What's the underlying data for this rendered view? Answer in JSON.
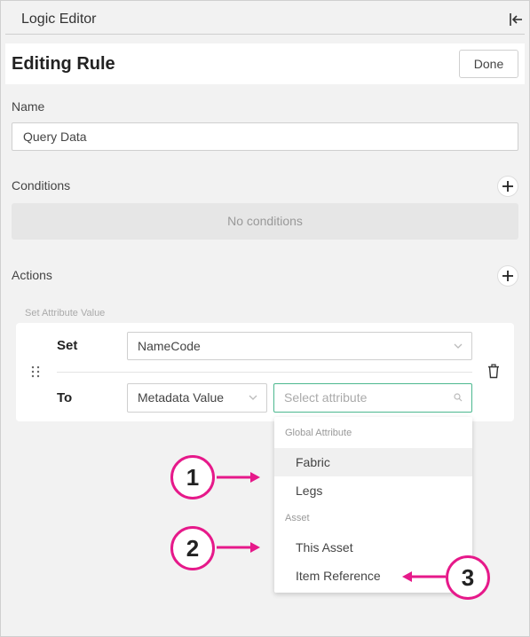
{
  "panel": {
    "title": "Logic Editor"
  },
  "rule": {
    "heading": "Editing Rule",
    "done_label": "Done"
  },
  "name_field": {
    "label": "Name",
    "value": "Query Data"
  },
  "conditions": {
    "label": "Conditions",
    "empty_text": "No conditions"
  },
  "actions": {
    "label": "Actions",
    "item": {
      "caption": "Set Attribute Value",
      "set_label": "Set",
      "set_value": "NameCode",
      "to_label": "To",
      "to_value": "Metadata Value",
      "attribute_placeholder": "Select attribute"
    }
  },
  "dropdown": {
    "groups": [
      {
        "header": "Global Attribute",
        "options": [
          "Fabric",
          "Legs"
        ]
      },
      {
        "header": "Asset",
        "options": [
          "This Asset",
          "Item Reference"
        ]
      }
    ]
  },
  "callouts": [
    "1",
    "2",
    "3"
  ],
  "colors": {
    "accent": "#e6198a",
    "focus": "#4cb88f"
  }
}
